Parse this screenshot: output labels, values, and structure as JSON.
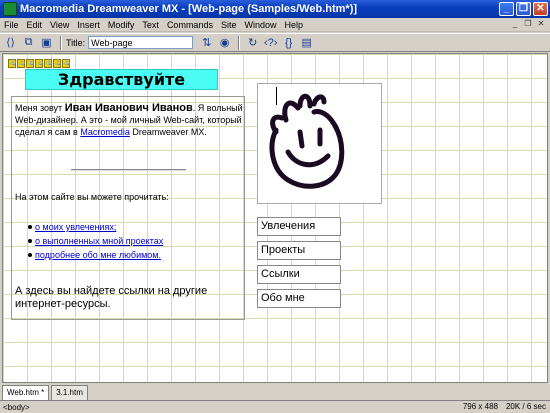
{
  "window": {
    "title": "Macromedia Dreamweaver MX - [Web-page (Samples/Web.htm*)]",
    "controls": [
      "minimize",
      "restore",
      "close"
    ]
  },
  "menu": [
    "File",
    "Edit",
    "View",
    "Insert",
    "Modify",
    "Text",
    "Commands",
    "Site",
    "Window",
    "Help"
  ],
  "toolbar": {
    "title_label": "Title:",
    "title_value": "Web-page"
  },
  "page": {
    "greeting": "Здравствуйте",
    "intro_prefix": "Меня зовут ",
    "name": "Иван Иванович Иванов",
    "intro_middle": ". Я вольный Web-дизайнер. А это - мой личный Web-сайт, который сделал я сам в ",
    "intro_link": "Macromedia",
    "intro_suffix": " Dreamweaver MX.",
    "read_heading": "На этом сайте вы можете прочитать:",
    "links": [
      "о моих увлечениях;",
      "о выполненных мной проектах",
      "подробнее обо мне любимом."
    ],
    "outro": "А здесь вы найдете ссылки на другие интернет-ресурсы.",
    "nav_buttons": [
      "Увлечения",
      "Проекты",
      "Ссылки",
      "Обо мне"
    ]
  },
  "tabs": [
    "Web.htm *",
    "3.1.htm"
  ],
  "status": {
    "tag": "<body>",
    "size": "796 x 488",
    "download": "20K / 6 sec"
  },
  "colors": {
    "greeting_bg": "#49fdf4",
    "titlebar": "#0a3fbf",
    "grid": "#d6dcb0",
    "link": "#0000cc"
  }
}
